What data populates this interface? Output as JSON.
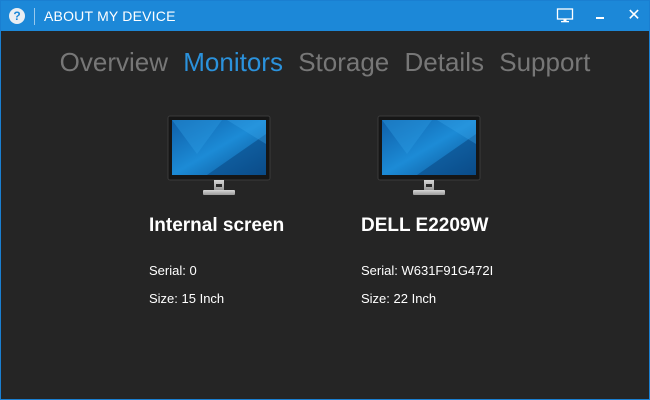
{
  "window": {
    "title": "ABOUT MY DEVICE",
    "help_icon": "?",
    "close_icon": "✕"
  },
  "tabs": [
    {
      "label": "Overview",
      "active": false
    },
    {
      "label": "Monitors",
      "active": true
    },
    {
      "label": "Storage",
      "active": false
    },
    {
      "label": "Details",
      "active": false
    },
    {
      "label": "Support",
      "active": false
    }
  ],
  "monitors": [
    {
      "name": "Internal screen",
      "serial": "Serial: 0",
      "size": "Size: 15 Inch"
    },
    {
      "name": "DELL E2209W",
      "serial": "Serial: W631F91G472I",
      "size": "Size: 22 Inch"
    }
  ],
  "colors": {
    "titlebar": "#1c88d8",
    "background": "#252525",
    "tab_active": "#2b92dc",
    "tab_inactive": "#777777"
  }
}
